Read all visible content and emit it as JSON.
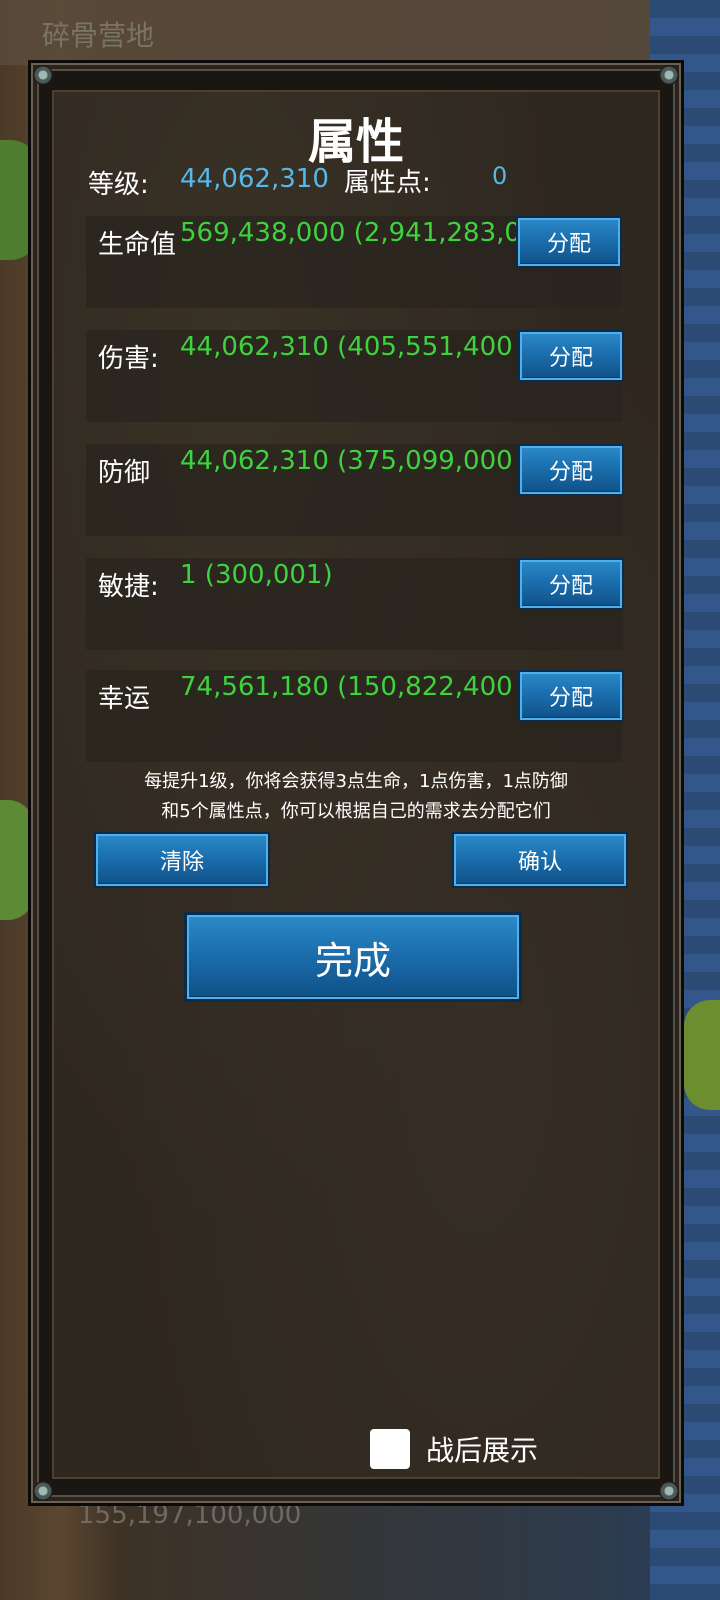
{
  "background": {
    "map_title": "碎骨营地",
    "footer_value": "155,197,100,000"
  },
  "dialog": {
    "title": "属性",
    "level_label": "等级:",
    "level_value": "44,062,310",
    "points_label": "属性点:",
    "points_value": "0",
    "attributes": [
      {
        "label": "生命值",
        "value": "569,438,000  (2,941,283,0",
        "button": "分配"
      },
      {
        "label": "伤害:",
        "value": "44,062,310  (405,551,400",
        "button": "分配"
      },
      {
        "label": "防御",
        "value": "44,062,310  (375,099,000",
        "button": "分配"
      },
      {
        "label": "敏捷:",
        "value": "1  (300,001)",
        "button": "分配"
      },
      {
        "label": "幸运",
        "value": "74,561,180  (150,822,400",
        "button": "分配"
      }
    ],
    "description_line1": "每提升1级，你将会获得3点生命，1点伤害，1点防御",
    "description_line2": "和5个属性点，你可以根据自己的需求去分配它们",
    "clear_label": "清除",
    "confirm_label": "确认",
    "done_label": "完成",
    "show_after_battle_label": "战后展示"
  },
  "colors": {
    "value_blue": "#56b8e8",
    "value_green": "#3fd23f",
    "button_blue": "#1b6fae"
  }
}
